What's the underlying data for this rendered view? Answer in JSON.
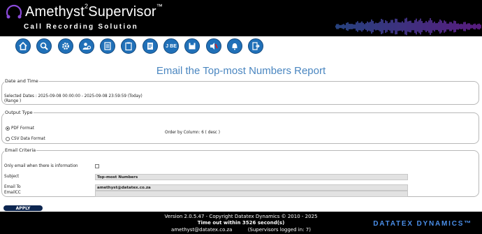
{
  "header": {
    "brand_main": "Amethyst",
    "brand_sup": "2",
    "brand_rest": "Supervisor",
    "brand_tm": "™",
    "tagline": "Call Recording Solution",
    "accent_color": "#7a3cd0"
  },
  "toolbar": {
    "buttons": [
      {
        "name": "home-icon"
      },
      {
        "name": "search-icon"
      },
      {
        "name": "gear-icon"
      },
      {
        "name": "user-settings-icon"
      },
      {
        "name": "report-list-icon"
      },
      {
        "name": "clipboard-icon"
      },
      {
        "name": "document-icon"
      },
      {
        "name": "jbe-icon",
        "label": "J BE"
      },
      {
        "name": "save-disk-icon"
      },
      {
        "name": "mute-speaker-icon"
      },
      {
        "name": "alarm-bell-icon"
      },
      {
        "name": "logout-icon"
      }
    ],
    "button_color": "#2070b8"
  },
  "title": "Email the Top-most Numbers Report",
  "date_section": {
    "legend": "Date and Time",
    "selected_dates": "Selected Dates : 2025-09-08 00:00:00 - 2025-09-08 23:59:59 (Today)",
    "range_note": "(Range )"
  },
  "output_section": {
    "legend": "Output Type",
    "pdf_label": "PDF Format",
    "csv_label": "CSV Data Format",
    "order_by": "Order by Column: 6  ( desc )"
  },
  "email_section": {
    "legend": "Email Criteria",
    "only_email_label": "Only email when there is information",
    "subject_label": "Subject",
    "subject_value": "Top-most Numbers",
    "email_to_label": "Email To",
    "email_to_value": "amethyst@datatex.co.za",
    "email_cc_label": "EmailCC",
    "email_cc_value": ""
  },
  "apply_label": "APPLY",
  "footer": {
    "version": "Version 2.0.5.47 - Copyright Datatex Dynamics © 2010 - 2025",
    "timeout": "Time out within 3526 second(s)",
    "user": "amethyst@datatex.co.za          (Supervisors logged in: 7)",
    "brand": "DATATEX DYNAMICS™"
  }
}
